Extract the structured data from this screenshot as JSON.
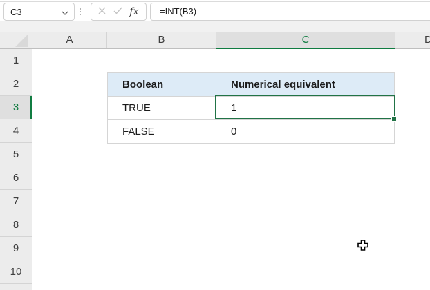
{
  "formula_bar": {
    "name_box_value": "C3",
    "formula": "=INT(B3)",
    "fx_label": "fx",
    "icons": {
      "dropdown": "chevron-down",
      "separator": "vertical-dots-grip",
      "cancel": "x-mark",
      "confirm": "check-mark",
      "insert_function": "fx"
    }
  },
  "grid": {
    "column_headers": [
      "A",
      "B",
      "C",
      "D"
    ],
    "selected_column": "C",
    "row_headers": [
      "1",
      "2",
      "3",
      "4",
      "5",
      "6",
      "7",
      "8",
      "9",
      "10"
    ],
    "selected_row": "3",
    "selected_cell": "C3",
    "selected_cell_value": "1"
  },
  "table": {
    "headers": [
      "Boolean",
      "Numerical equivalent"
    ],
    "rows": [
      [
        "TRUE",
        "1"
      ],
      [
        "FALSE",
        "0"
      ]
    ]
  },
  "colors": {
    "accent_green": "#217346",
    "header_fill_blue": "#DDEBF7",
    "table_border": "#D5D5D5"
  }
}
